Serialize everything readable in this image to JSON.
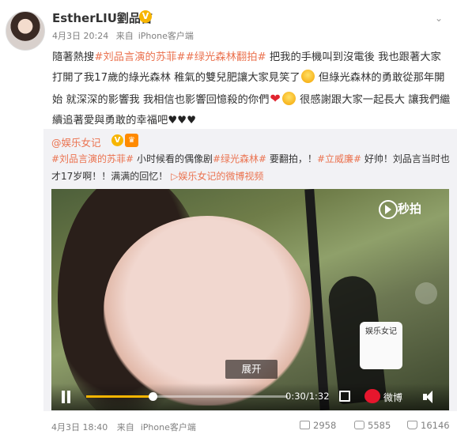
{
  "header": {
    "username": "EstherLIU劉品言",
    "verified_mark": "V",
    "date": "4月3日 20:24",
    "source_prefix": "来自",
    "source": "iPhone客户端"
  },
  "post": {
    "text_1": "隨著熱搜",
    "tag_1": "#刘品言演的苏菲#",
    "tag_2": "#绿光森林翻拍#",
    "text_2": "把我的手機叫到沒電後 我也跟著大家打開了我17歲的綠光森林 稚氣的雙兒肥讓大家見笑了",
    "text_3": "但綠光森林的勇敢從那年開始 就深深的影響我 我相信也影響回憶殺的你們",
    "text_4": "很感謝跟大家一起長大 讓我們繼續追著愛與勇敢的幸福吧",
    "hearts": "♥♥♥",
    "heart_emoji": "❤"
  },
  "repost": {
    "user": "@娱乐女记",
    "badge_1": "V",
    "badge_2": "♛",
    "tag_1": "#刘品言演的苏菲#",
    "text_1": "小时候看的偶像剧",
    "tag_2": "#绿光森林#",
    "text_2": "要翻拍，！",
    "tag_3": "#立威廉#",
    "text_3": "好帅！刘品言当时也才17岁啊！！满满的回忆！",
    "video_link": "娱乐女记的微博视频"
  },
  "video": {
    "watermark": "秒拍",
    "overlay_tag": "娱乐女记",
    "expand_label": "展开",
    "time": "0:30/1:32",
    "progress": 0.33,
    "weibo_label": "微博"
  },
  "footer": {
    "date": "4月3日 18:40",
    "source_prefix": "来自",
    "source": "iPhone客户端",
    "shares": "2958",
    "comments": "5585",
    "likes": "16146"
  },
  "icons": {
    "caret": "chevron-down-icon",
    "play_watermark": "play-circle-icon",
    "accent": "#eb7350",
    "badge": "#f7b500"
  }
}
